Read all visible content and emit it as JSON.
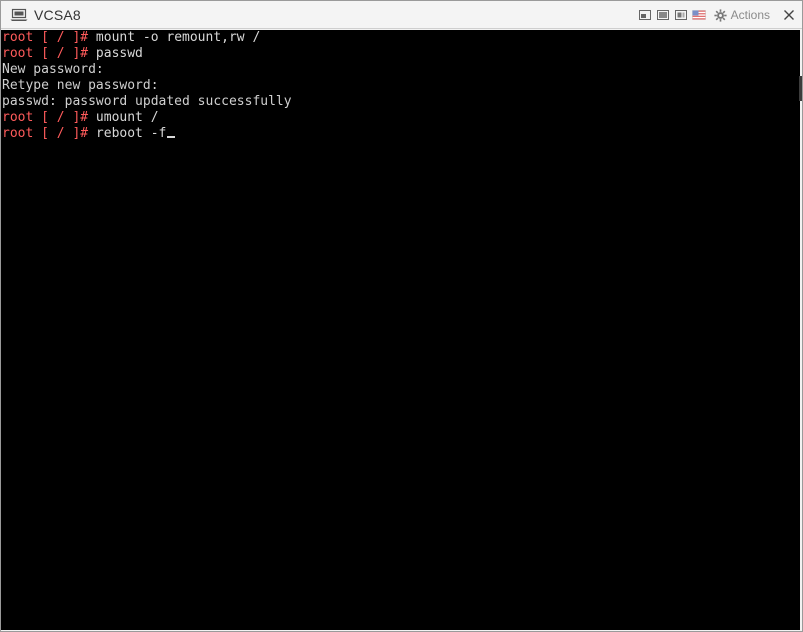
{
  "window": {
    "title": "VCSA8",
    "actions_label": "Actions"
  },
  "icons": {
    "vm": "vm-console-icon",
    "fit": "fit-window-icon",
    "fullscreen": "full-screen-icon",
    "send_keys": "send-keys-icon",
    "keyboard": "keyboard-layout-flag-icon",
    "gear": "gear-icon",
    "close": "close-icon"
  },
  "colors": {
    "prompt": "#ff5b5b",
    "text": "#d8d8d8",
    "background": "#000000"
  },
  "console": {
    "lines": [
      {
        "prompt": "root [ / ]# ",
        "text": "mount -o remount,rw /"
      },
      {
        "prompt": "root [ / ]# ",
        "text": "passwd"
      },
      {
        "prompt": "",
        "text": "New password:"
      },
      {
        "prompt": "",
        "text": "Retype new password:"
      },
      {
        "prompt": "",
        "text": "passwd: password updated successfully"
      },
      {
        "prompt": "root [ / ]# ",
        "text": "umount /"
      },
      {
        "prompt": "root [ / ]# ",
        "text": "reboot -f"
      }
    ]
  }
}
